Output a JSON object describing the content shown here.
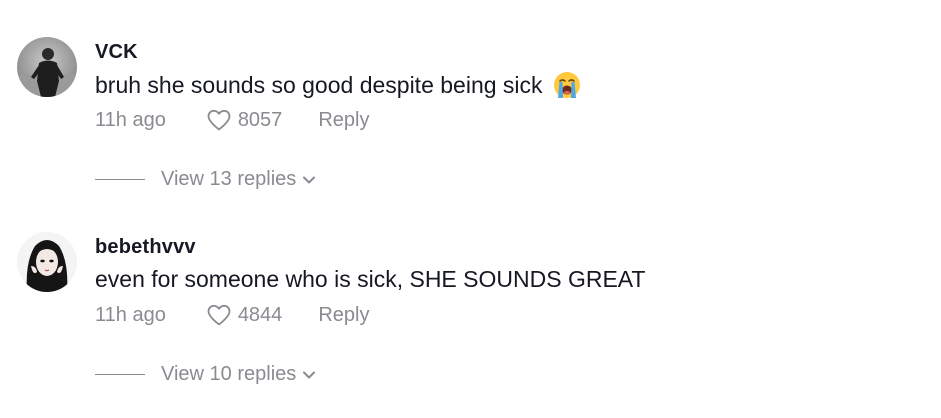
{
  "comments": [
    {
      "username": "VCK",
      "text": "bruh she sounds so good despite being sick",
      "emoji": "loudly-crying-face",
      "time": "11h ago",
      "likes": "8057",
      "reply_label": "Reply",
      "view_replies": "View 13 replies"
    },
    {
      "username": "bebethvvv",
      "text": "even for someone who is sick, SHE SOUNDS GREAT",
      "time": "11h ago",
      "likes": "4844",
      "reply_label": "Reply",
      "view_replies": "View 10 replies"
    }
  ],
  "colors": {
    "primary_text": "#161823",
    "secondary_text": "#8a8b91",
    "background": "#ffffff"
  },
  "icons": [
    "heart-outline-icon",
    "chevron-down-icon",
    "loudly-crying-face-emoji"
  ]
}
